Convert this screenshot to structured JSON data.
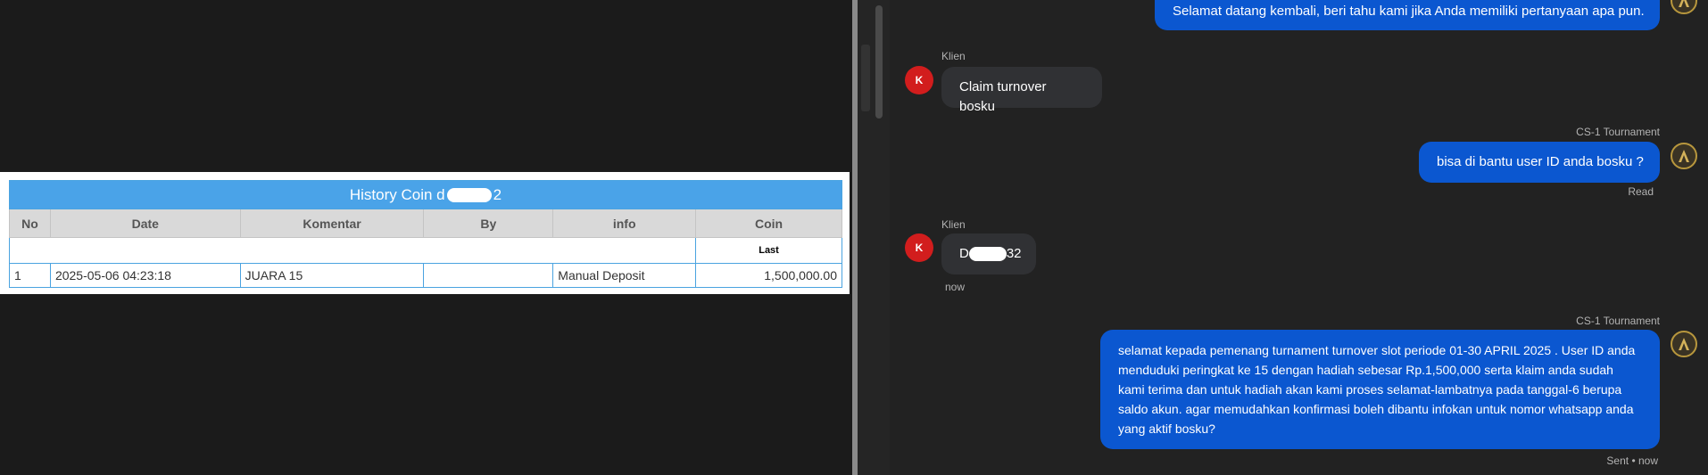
{
  "history": {
    "title_prefix": "History Coin d",
    "title_suffix": "2",
    "columns": [
      "No",
      "Date",
      "Komentar",
      "By",
      "info",
      "Coin"
    ],
    "last_label": "Last",
    "rows": [
      {
        "no": "1",
        "date": "2025-05-06 04:23:18",
        "komentar": "JUARA 15",
        "by": "",
        "info": "Manual Deposit",
        "coin": "1,500,000.00"
      }
    ]
  },
  "chat": {
    "messages": [
      {
        "text": "Selamat datang kembali, beri tahu kami jika Anda memiliki pertanyaan apa pun."
      },
      {
        "sender": "Klien",
        "avatar": "K",
        "text": "Claim turnover bosku"
      },
      {
        "sender": "CS-1 Tournament",
        "text": "bisa di bantu user ID anda bosku ?",
        "status": "Read"
      },
      {
        "sender": "Klien",
        "avatar": "K",
        "text_prefix": "D",
        "text_suffix": "32",
        "status": "now"
      },
      {
        "sender": "CS-1 Tournament",
        "text": "selamat kepada pemenang turnament turnover slot periode 01-30 APRIL 2025 . User ID anda menduduki peringkat ke 15 dengan hadiah sebesar Rp.1,500,000 serta klaim anda sudah kami terima dan untuk hadiah akan kami proses selamat-lambatnya pada tanggal-6 berupa saldo akun. agar memudahkan konfirmasi boleh dibantu infokan untuk nomor whatsapp anda yang aktif bosku?",
        "status": "Sent • now"
      }
    ]
  }
}
